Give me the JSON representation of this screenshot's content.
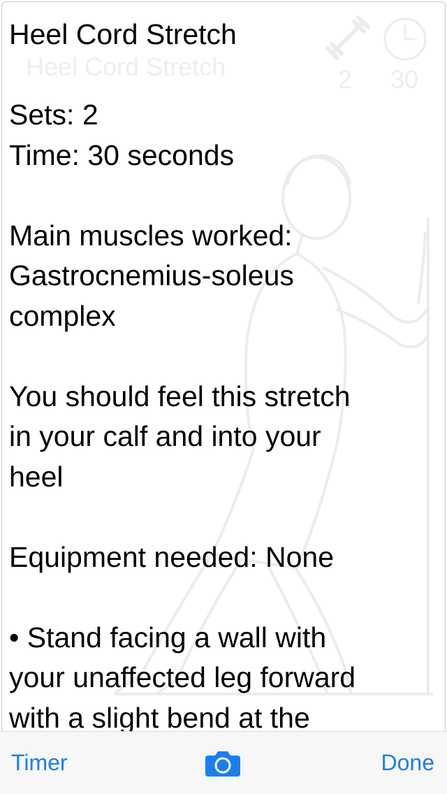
{
  "header": {
    "title": "Heel Cord Stretch",
    "faded_title": "Heel Cord Stretch",
    "faded_sets_value": "2",
    "faded_time_value": "30"
  },
  "content": {
    "sets_line": "Sets: 2",
    "time_line": "Time: 30 seconds",
    "muscles_line1": "Main muscles worked:",
    "muscles_line2": "Gastrocnemius-soleus",
    "muscles_line3": "complex",
    "feel_line1": "You should feel this stretch",
    "feel_line2": "in your calf and into your",
    "feel_line3": "heel",
    "equipment_line": "Equipment needed: None",
    "step1_line1": "• Stand facing a wall with",
    "step1_line2": "your unaffected leg forward",
    "step1_line3": "with a slight bend at the"
  },
  "toolbar": {
    "timer_label": "Timer",
    "done_label": "Done",
    "camera_icon": "camera-icon"
  },
  "colors": {
    "accent": "#1a7ef2",
    "text": "#000000",
    "faded": "#eeeeee",
    "toolbar_bg": "#f7f7f7"
  }
}
